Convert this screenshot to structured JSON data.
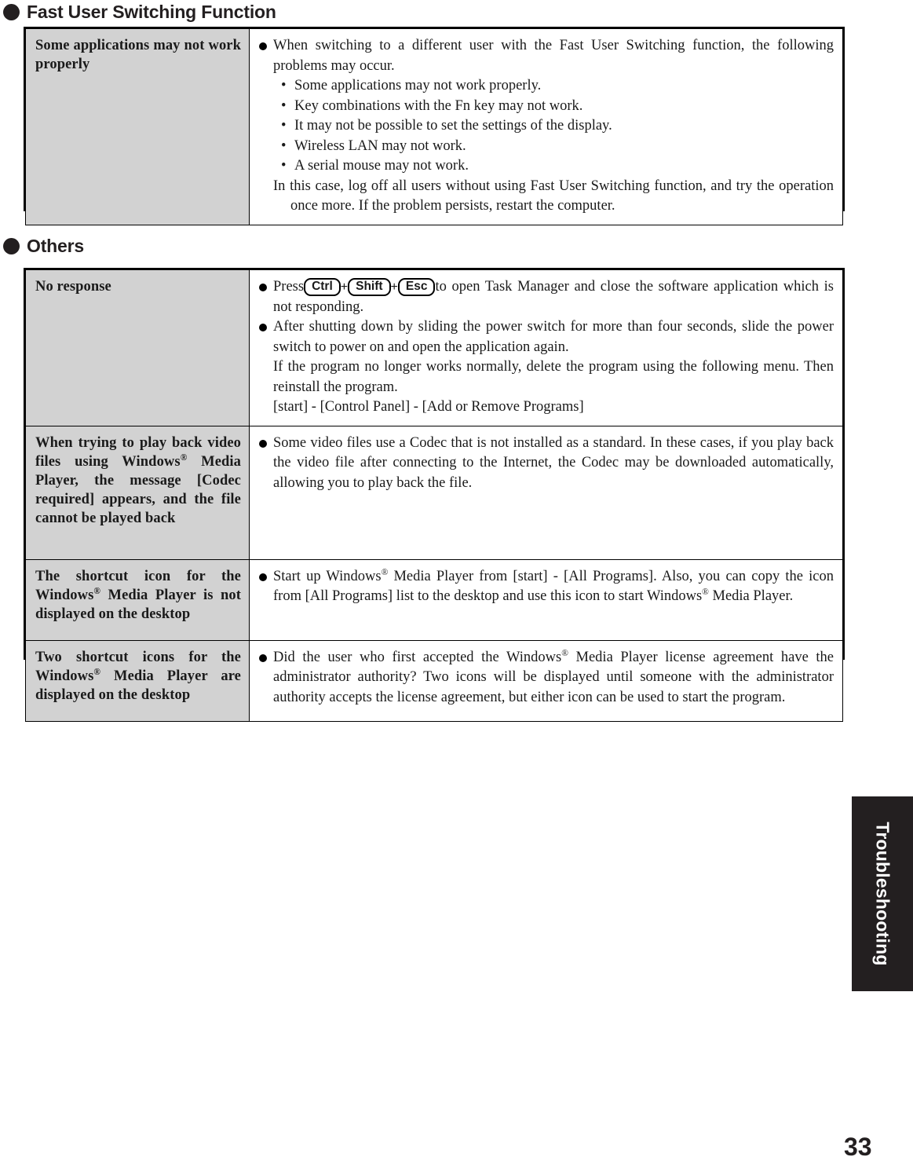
{
  "page": {
    "number": "33",
    "side_tab_label": "Troubleshooting"
  },
  "sections": [
    {
      "heading": "Fast User Switching Function",
      "rows": [
        {
          "label": "Some applications may not work properly",
          "intro": "When switching to a different user with the Fast User Switching function, the following problems may occur.",
          "bullets": [
            "Some applications may not work properly.",
            "Key combinations with the Fn key may not work.",
            "It may not be possible to set the settings of the display.",
            "Wireless LAN may not work.",
            "A serial mouse may not work."
          ],
          "closing": "In this case, log off all users without using Fast User Switching function, and try the operation once more. If the problem persists, restart the computer."
        }
      ]
    },
    {
      "heading": "Others",
      "rows": [
        {
          "label": "No response",
          "para1_pre": "Press",
          "keys": [
            "Ctrl",
            "Shift",
            "Esc"
          ],
          "para1_post": "to open Task Manager and close the software application which is not responding.",
          "para2": "After shutting down by sliding the power switch for more than four seconds, slide the power switch to power on and open the application again.",
          "para3": "If the program no longer works normally, delete the program using the following menu. Then reinstall the program.",
          "para4": "[start] - [Control Panel] - [Add or Remove Programs]"
        },
        {
          "label_pre": "When trying to play back video files using Windows",
          "label_post": " Media Player, the message [Codec required] appears, and the file cannot be played back",
          "body": "Some video files use a Codec that is not installed as a standard. In these cases, if you play back the video file after connecting to the Internet, the Codec may be downloaded automatically, allowing you to play back the file."
        },
        {
          "label_pre": "The shortcut icon for the Windows",
          "label_post": " Media Player is not displayed on the desktop",
          "body_a": "Start up Windows",
          "body_b": " Media Player from [start] - [All Programs]. Also, you can copy the icon from [All Programs] list to the desktop and use this icon to start Windows",
          "body_c": " Media Player."
        },
        {
          "label_pre": "Two shortcut icons for the Windows",
          "label_post": " Media Player are displayed on the desktop",
          "body_a": "Did the user who first accepted the Windows",
          "body_b": " Media Player license agreement have the administrator authority?  Two icons will be displayed until someone with the administrator authority accepts the license agreement, but either icon can be used to start the program."
        }
      ]
    }
  ],
  "symbols": {
    "registered": "®",
    "small_bullet": "•",
    "plus": "+"
  }
}
